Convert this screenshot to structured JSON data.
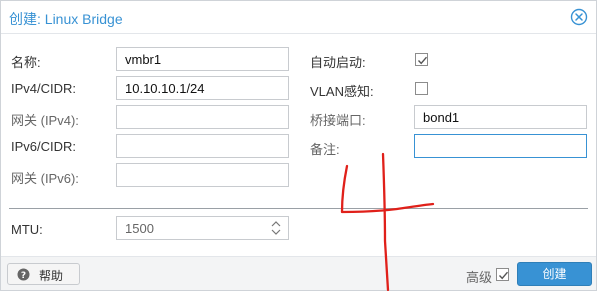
{
  "window": {
    "title": "创建: Linux Bridge"
  },
  "left_fields": {
    "name": {
      "label": "名称:",
      "value": "vmbr1"
    },
    "ipv4": {
      "label": "IPv4/CIDR:",
      "value": "10.10.10.1/24"
    },
    "gateway4": {
      "label": "网关 (IPv4):",
      "value": ""
    },
    "ipv6": {
      "label": "IPv6/CIDR:",
      "value": ""
    },
    "gateway6": {
      "label": "网关 (IPv6):",
      "value": ""
    }
  },
  "right_fields": {
    "autostart": {
      "label": "自动启动:",
      "checked": true
    },
    "vlan_aware": {
      "label": "VLAN感知:",
      "checked": false
    },
    "bridge_ports": {
      "label": "桥接端口:",
      "value": "bond1"
    },
    "comment": {
      "label": "备注:",
      "value": ""
    }
  },
  "mtu": {
    "label": "MTU:",
    "value": "1500"
  },
  "footer": {
    "help_label": "帮助",
    "advanced_label": "高级",
    "advanced_checked": true,
    "create_label": "创建"
  },
  "colors": {
    "accent": "#3892d4",
    "annotation": "#e0201a"
  }
}
